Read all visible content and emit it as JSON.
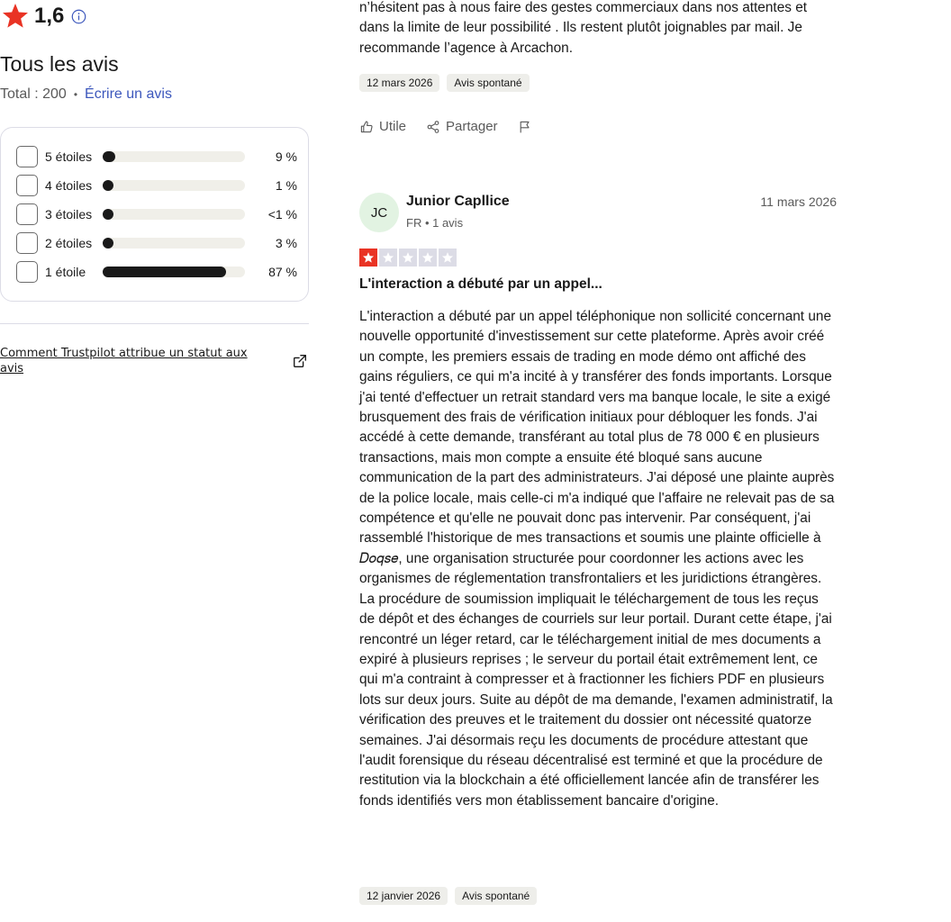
{
  "summary": {
    "score": "1,6",
    "title": "Tous les avis",
    "total_label": "Total : 200",
    "write_review": "Écrire un avis",
    "distribution": [
      {
        "label": "5 étoiles",
        "pct_text": "9 %",
        "fraction": 0.09
      },
      {
        "label": "4 étoiles",
        "pct_text": "1 %",
        "fraction": 0.01
      },
      {
        "label": "3 étoiles",
        "pct_text": "<1 %",
        "fraction": 0.005
      },
      {
        "label": "2 étoiles",
        "pct_text": "3 %",
        "fraction": 0.03
      },
      {
        "label": "1 étoile",
        "pct_text": "87 %",
        "fraction": 0.87
      }
    ],
    "how_link": "Comment Trustpilot attribue un statut aux avis"
  },
  "previous_review": {
    "text_tail": "n’hésitent pas à nous faire des gestes commerciaux dans nos attentes et dans la limite de leur possibilité . Ils restent plutôt joignables par mail. Je recommande l’agence à Arcachon.",
    "date_tag": "12 mars 2026",
    "type_tag": "Avis spontané",
    "useful_label": "Utile",
    "share_label": "Partager"
  },
  "review": {
    "initials": "JC",
    "name": "Junior Capllice",
    "meta": "FR • 1 avis",
    "date": "11 mars 2026",
    "rating": 1,
    "title": "L'interaction a débuté par un appel...",
    "body": "L'interaction a débuté par un appel téléphonique non sollicité concernant une nouvelle opportunité d'investissement sur cette plateforme. Après avoir créé un compte, les premiers essais de trading en mode démo ont affiché des gains réguliers, ce qui m'a incité à y transférer des fonds importants. Lorsque j'ai tenté d'effectuer un retrait standard vers ma banque locale, le site a exigé brusquement des frais de vérification initiaux pour débloquer les fonds. J'ai accédé à cette demande, transférant au total plus de 78 000 € en plusieurs transactions, mais mon compte a ensuite été bloqué sans aucune communication de la part des administrateurs. J'ai déposé une plainte auprès de la police locale, mais celle-ci m'a indiqué que l'affaire ne relevait pas de sa compétence et qu'elle ne pouvait donc pas intervenir. Par conséquent, j'ai rassemblé l'historique de mes transactions et soumis une plainte officielle à 𝐷𝑜𝑞𝑠𝑒, une organisation structurée pour coordonner les actions avec les organismes de réglementation transfrontaliers et les juridictions étrangères. La procédure de soumission impliquait le téléchargement de tous les reçus de dépôt et des échanges de courriels sur leur portail. Durant cette étape, j'ai rencontré un léger retard, car le téléchargement initial de mes documents a expiré à plusieurs reprises ; le serveur du portail était extrêmement lent, ce qui m'a contraint à compresser et à fractionner les fichiers PDF en plusieurs lots sur deux jours. Suite au dépôt de ma demande, l'examen administratif, la vérification des preuves et le traitement du dossier ont nécessité quatorze semaines. J'ai désormais reçu les documents de procédure attestant que l'audit forensique du réseau décentralisé est terminé et que la procédure de restitution via la blockchain a été officiellement lancée afin de transférer les fonds identifiés vers mon établissement bancaire d'origine.",
    "date_tag": "12 janvier 2026",
    "type_tag": "Avis spontané"
  },
  "colors": {
    "accent_star": "#e93324",
    "link_blue": "#3c57bc",
    "bar_fill": "#191919",
    "avatar_bg": "#e2f3e2",
    "empty_star_bg": "#dcdce6"
  },
  "icons": [
    "star-icon",
    "info-icon",
    "external-link-icon",
    "thumbs-up-icon",
    "share-icon",
    "flag-icon"
  ]
}
